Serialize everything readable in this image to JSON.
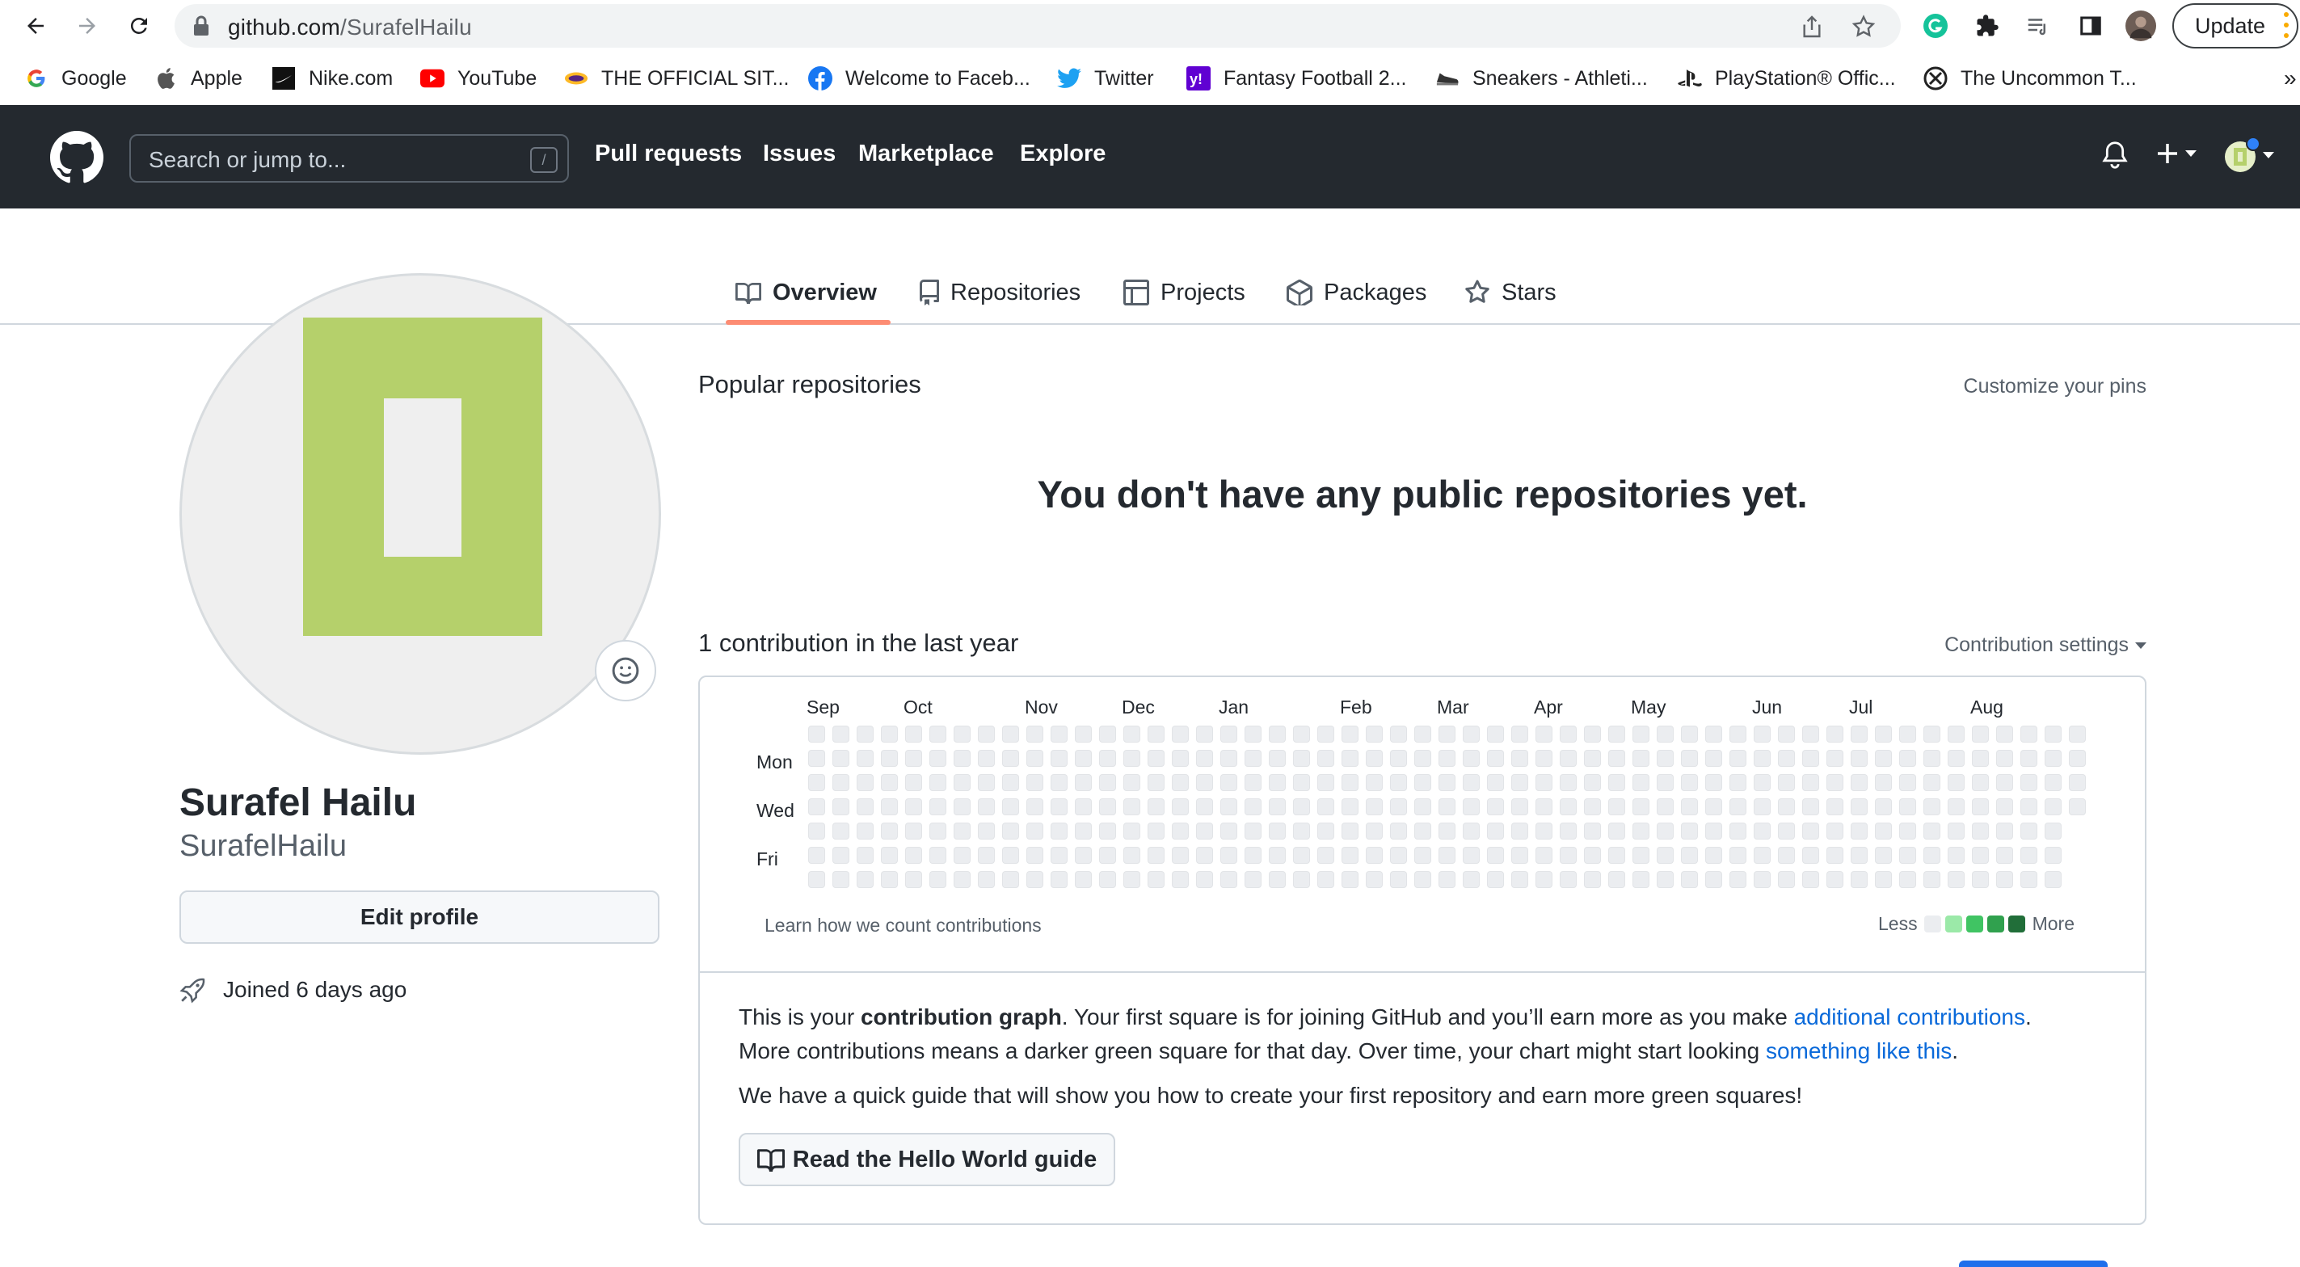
{
  "browser": {
    "url_host": "github.com",
    "url_path": "/SurafelHailu",
    "update_label": "Update",
    "bookmarks": [
      "Google",
      "Apple",
      "Nike.com",
      "YouTube",
      "THE OFFICIAL SIT...",
      "Welcome to Faceb...",
      "Twitter",
      "Fantasy Football 2...",
      "Sneakers - Athleti...",
      "PlayStation® Offic...",
      "The Uncommon T..."
    ],
    "bookmarks_overflow": "»"
  },
  "header": {
    "search_placeholder": "Search or jump to...",
    "search_shortcut": "/",
    "nav": [
      "Pull requests",
      "Issues",
      "Marketplace",
      "Explore"
    ]
  },
  "tabs": [
    "Overview",
    "Repositories",
    "Projects",
    "Packages",
    "Stars"
  ],
  "profile": {
    "full_name": "Surafel Hailu",
    "login": "SurafelHailu",
    "edit_profile_label": "Edit profile",
    "joined": "Joined 6 days ago",
    "avatar_color": "#b5d06b"
  },
  "popular": {
    "title": "Popular repositories",
    "customize_link": "Customize your pins",
    "empty_message": "You don't have any public repositories yet."
  },
  "contributions": {
    "title": "1 contribution in the last year",
    "settings_label": "Contribution settings",
    "months": [
      "Sep",
      "Oct",
      "Nov",
      "Dec",
      "Jan",
      "Feb",
      "Mar",
      "Apr",
      "May",
      "Jun",
      "Jul",
      "Aug"
    ],
    "day_labels": [
      "Mon",
      "Wed",
      "Fri"
    ],
    "learn_link": "Learn how we count contributions",
    "legend_less": "Less",
    "legend_more": "More",
    "legend_colors": [
      "#ebedf0",
      "#9be9a8",
      "#40c463",
      "#30a14e",
      "#216e39"
    ],
    "weeks": 53,
    "last_week_days": 4,
    "active_cell": {
      "week": 52,
      "day": 4,
      "level": 4
    }
  },
  "info": {
    "p1_a": "This is your ",
    "p1_bold": "contribution graph",
    "p1_b": ". Your first square is for joining GitHub and you’ll earn more as you make ",
    "p1_link": "additional contributions",
    "p1_c": ".",
    "p2_a": "More contributions means a darker green square for that day. Over time, your chart might start looking ",
    "p2_link": "something like this",
    "p2_b": ".",
    "p3": "We have a quick guide that will show you how to create your first repository and earn more green squares!",
    "guide_button": "Read the Hello World guide"
  }
}
